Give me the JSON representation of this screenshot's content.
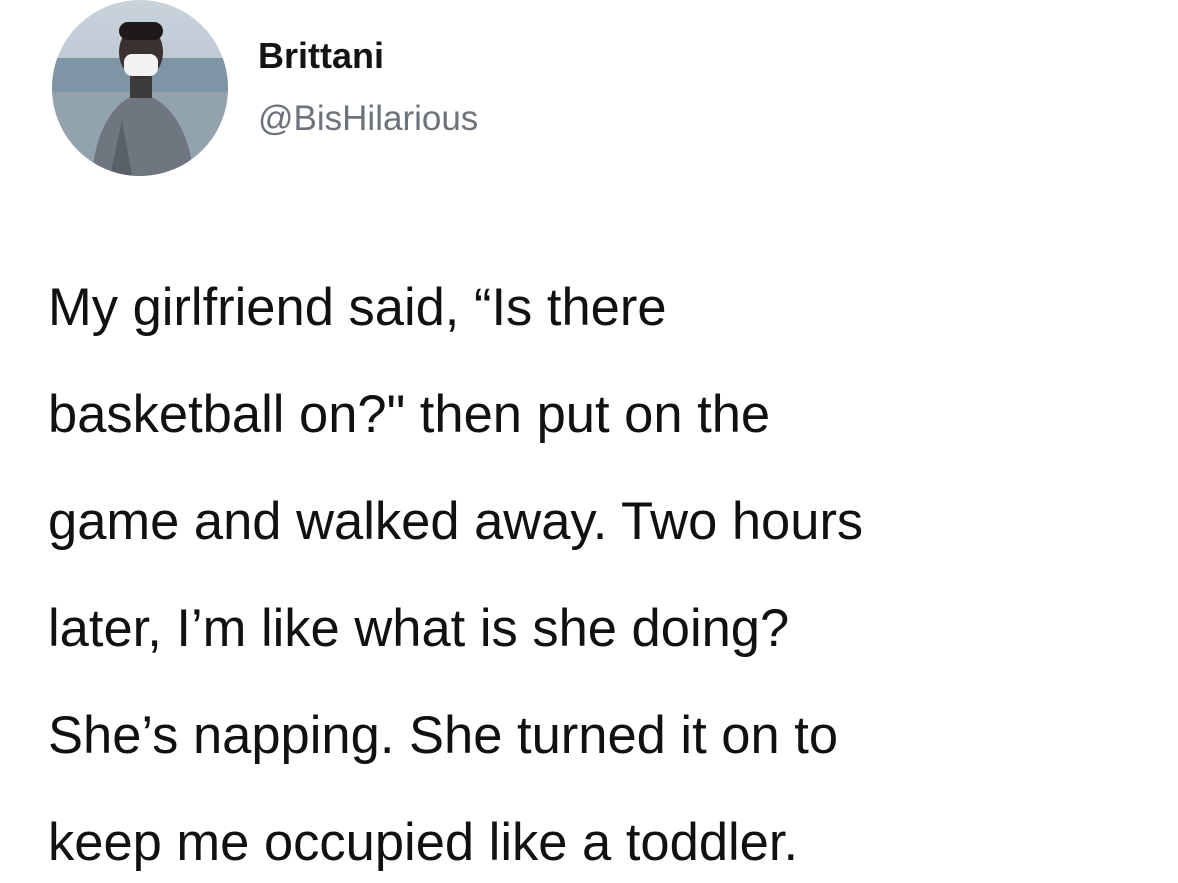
{
  "user": {
    "name": "Brittani",
    "handle": "@BisHilarious",
    "avatar_icon": "user-avatar-photo"
  },
  "tweet": {
    "lines": [
      "My girlfriend said, “Is there",
      "basketball on?\" then put on the",
      "game and walked away. Two hours",
      "later, I’m like what is she doing?",
      "She’s napping. She turned it on to",
      "keep me occupied like a toddler."
    ]
  }
}
